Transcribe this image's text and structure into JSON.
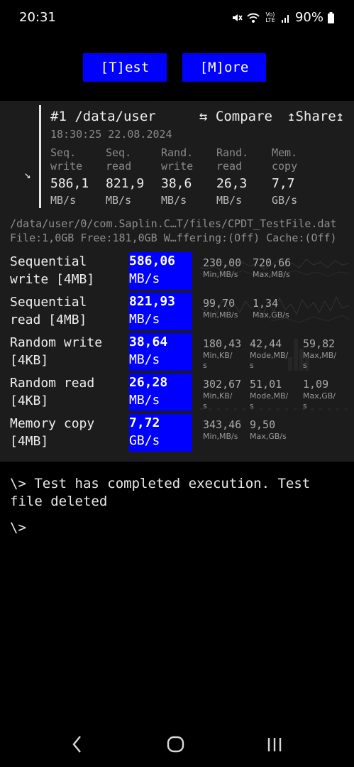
{
  "status": {
    "time": "20:31",
    "battery": "90%",
    "network_badge": "Vo) LTE"
  },
  "toolbar": {
    "test_label": "[T]est",
    "more_label": "[M]ore"
  },
  "card": {
    "title": "#1 /data/user",
    "compare_label": "⇆ Compare",
    "share_label": "↥Share↥",
    "datetime": "18:30:25 22.08.2024",
    "metrics": [
      {
        "line1": "Seq.",
        "line2": "write",
        "value": "586,1",
        "unit": "MB/s"
      },
      {
        "line1": "Seq.",
        "line2": "read",
        "value": "821,9",
        "unit": "MB/s"
      },
      {
        "line1": "Rand.",
        "line2": "write",
        "value": "38,6",
        "unit": "MB/s"
      },
      {
        "line1": "Rand.",
        "line2": "read",
        "value": "26,3",
        "unit": "MB/s"
      },
      {
        "line1": "Mem.",
        "line2": "copy",
        "value": "7,7",
        "unit": "GB/s"
      }
    ]
  },
  "file_info": {
    "path": "/data/user/0/com.Saplin.C…T/files/CPDT_TestFile.dat",
    "details": "File:1,0GB Free:181,0GB W…ffering:(Off) Cache:(Off)"
  },
  "results": [
    {
      "label1": "Sequential",
      "label2": "write [4MB]",
      "value": "586,06",
      "unit": "MB/s",
      "stats": [
        {
          "value": "230,00",
          "label": "Min,MB/s"
        },
        {
          "value": "720,66",
          "label": "Max,MB/s"
        }
      ]
    },
    {
      "label1": "Sequential",
      "label2": "read [4MB]",
      "value": "821,93",
      "unit": "MB/s",
      "stats": [
        {
          "value": "99,70",
          "label": "Min,MB/s"
        },
        {
          "value": "1,34",
          "label": "Max,GB/s"
        }
      ]
    },
    {
      "label1": "Random write",
      "label2": "[4KB]",
      "value": "38,64",
      "unit": "MB/s",
      "stats": [
        {
          "value": "180,43",
          "label": "Min,KB/",
          "label2": "s"
        },
        {
          "value": "42,44",
          "label": "Mode,MB/",
          "label2": "s"
        },
        {
          "value": "59,82",
          "label": "Max,MB/",
          "label2": "s"
        }
      ]
    },
    {
      "label1": "Random read",
      "label2": "[4KB]",
      "value": "26,28",
      "unit": "MB/s",
      "stats": [
        {
          "value": "302,67",
          "label": "Min,KB/",
          "label2": "s"
        },
        {
          "value": "51,01",
          "label": "Mode,MB/",
          "label2": "s"
        },
        {
          "value": "1,09",
          "label": "Max,GB/",
          "label2": "s"
        }
      ]
    },
    {
      "label1": "Memory copy",
      "label2": "[4MB]",
      "value": "7,72",
      "unit": "GB/s",
      "stats": [
        {
          "value": "343,46",
          "label": "Min,MB/s"
        },
        {
          "value": "9,50",
          "label": "Max,GB/s"
        }
      ]
    }
  ],
  "console": {
    "message_line1": "\\> Test has completed execution. Test",
    "message_line2": "file deleted",
    "prompt": "\\>"
  }
}
